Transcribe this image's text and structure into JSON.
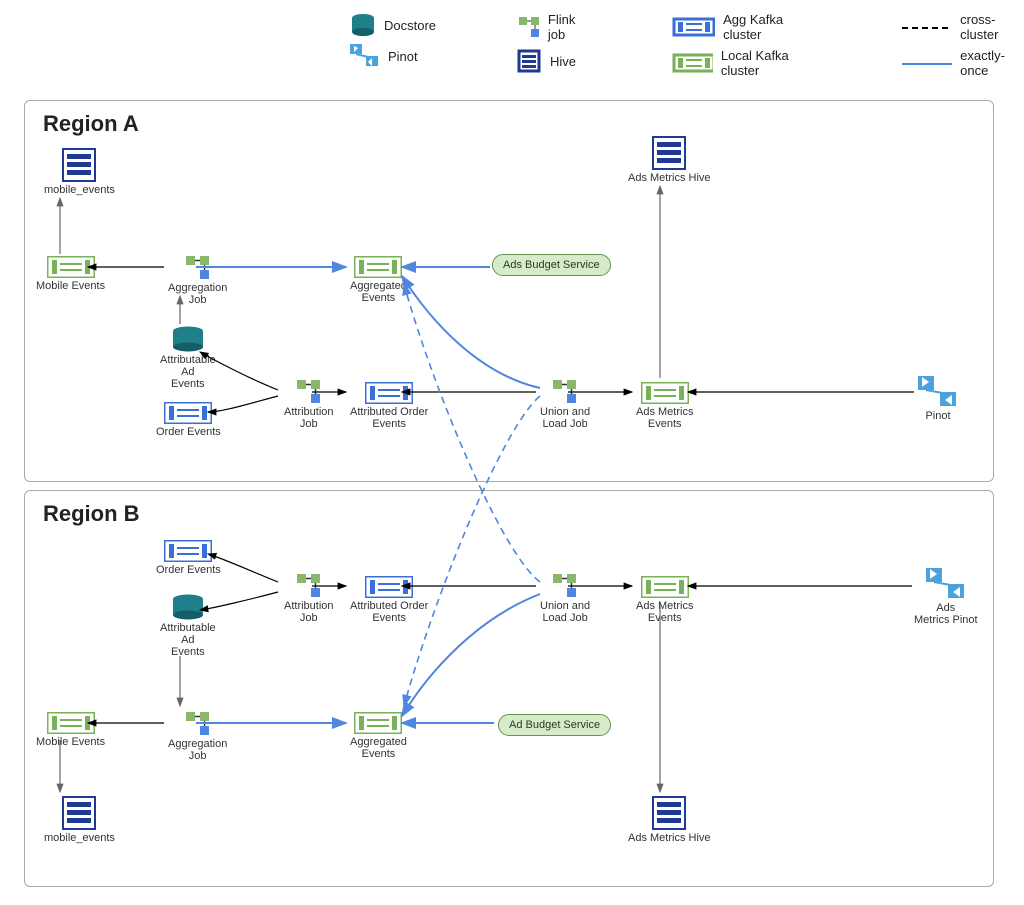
{
  "legend": {
    "docstore": "Docstore",
    "pinot": "Pinot",
    "flink": "Flink job",
    "hive": "Hive",
    "agg_kafka": "Agg Kafka cluster",
    "local_kafka": "Local Kafka cluster",
    "cross_cluster": "cross-cluster",
    "exactly_once": "exactly-once"
  },
  "regions": {
    "a": {
      "title": "Region A"
    },
    "b": {
      "title": "Region B"
    }
  },
  "nodes": {
    "a_mobile_events_hive": "mobile_events",
    "a_mobile_events": "Mobile Events",
    "a_aggregation_job": "Aggregation\nJob",
    "a_aggregated_events": "Aggregated\nEvents",
    "a_ads_budget": "Ads Budget\nService",
    "a_attributable": "Attributable\nAd\nEvents",
    "a_order_events": "Order Events",
    "a_attribution_job": "Attribution\nJob",
    "a_attributed_order": "Attributed Order\nEvents",
    "a_union_load": "Union and\nLoad Job",
    "a_ads_metrics_events": "Ads Metrics\nEvents",
    "a_ads_metrics_hive": "Ads Metrics Hive",
    "a_pinot": "Pinot",
    "b_order_events": "Order Events",
    "b_attributable": "Attributable\nAd\nEvents",
    "b_attribution_job": "Attribution\nJob",
    "b_attributed_order": "Attributed Order\nEvents",
    "b_union_load": "Union and\nLoad Job",
    "b_ads_metrics_events": "Ads Metrics\nEvents",
    "b_ads_metrics_pinot": "Ads\nMetrics Pinot",
    "b_mobile_events": "Mobile Events",
    "b_aggregation_job": "Aggregation\nJob",
    "b_aggregated_events": "Aggregated\nEvents",
    "b_ad_budget": "Ad Budget Service",
    "b_mobile_events_hive": "mobile_events",
    "b_ads_metrics_hive": "Ads Metrics Hive"
  },
  "colors": {
    "kafka_blue": "#3a6fd8",
    "kafka_green": "#79b159",
    "hive": "#1f3a93",
    "flink_g": "#89b86c",
    "flink_b": "#4f86e0",
    "doc_teal": "#1f7f8a",
    "pinot_blue": "#4aa3df",
    "exactly": "#4f86e0",
    "wire": "#000"
  }
}
